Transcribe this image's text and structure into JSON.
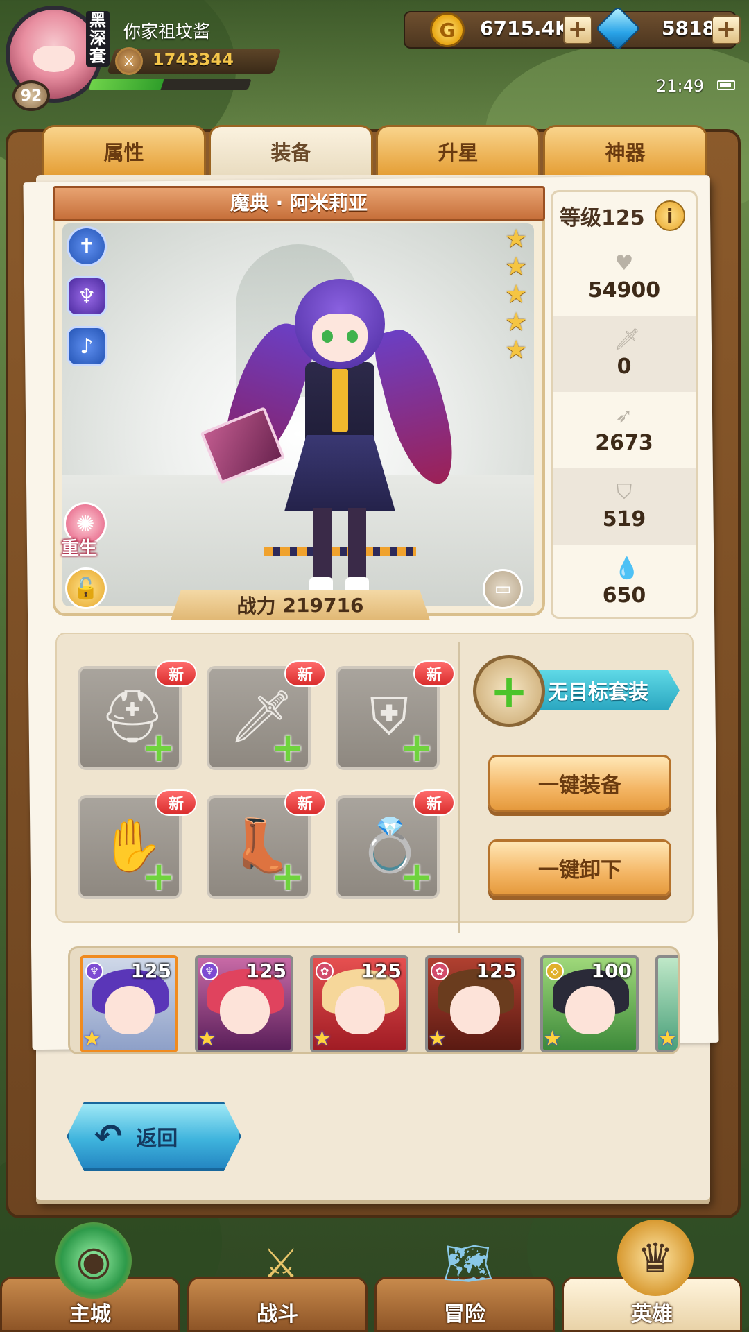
{
  "player": {
    "name": "你家祖坟酱",
    "rank_tag": "黑\n深\n套",
    "level": "92",
    "power": "1743344",
    "xp_fraction": 0.45
  },
  "currency": {
    "gold": "6715.4K",
    "gems": "5818"
  },
  "status": {
    "time": "21:49"
  },
  "tabs": [
    {
      "label": "属性"
    },
    {
      "label": "装备"
    },
    {
      "label": "升星"
    },
    {
      "label": "神器"
    }
  ],
  "active_tab": 1,
  "hero": {
    "name": "魔典 · 阿米莉亚",
    "stars": 5,
    "power_label": "战力",
    "power_value": "219716",
    "rebirth_label": "重生"
  },
  "stats": {
    "level_label": "等级125",
    "rows": [
      {
        "icon": "heart-icon",
        "value": "54900"
      },
      {
        "icon": "sword-icon",
        "value": "0"
      },
      {
        "icon": "arrow-icon",
        "value": "2673"
      },
      {
        "icon": "shield-icon",
        "value": "519"
      },
      {
        "icon": "drop-icon",
        "value": "650"
      }
    ]
  },
  "equipment": {
    "new_label": "新",
    "slots": [
      {
        "name": "helmet"
      },
      {
        "name": "weapon"
      },
      {
        "name": "armor"
      },
      {
        "name": "gloves"
      },
      {
        "name": "boots"
      },
      {
        "name": "ring"
      }
    ],
    "set_label": "无目标套装",
    "equip_all_label": "一键装备",
    "unequip_all_label": "一键卸下"
  },
  "roster": [
    {
      "level": "125",
      "selected": true
    },
    {
      "level": "125",
      "selected": false
    },
    {
      "level": "125",
      "selected": false
    },
    {
      "level": "125",
      "selected": false
    },
    {
      "level": "100",
      "selected": false
    }
  ],
  "back_label": "返回",
  "nav": [
    {
      "label": "主城"
    },
    {
      "label": "战斗"
    },
    {
      "label": "冒险"
    },
    {
      "label": "英雄"
    }
  ],
  "colors": {
    "tab_gold": "#e59f36",
    "accent_cyan": "#2aa6c0",
    "new_red": "#d92c2c",
    "plus_green": "#6fd33d"
  }
}
